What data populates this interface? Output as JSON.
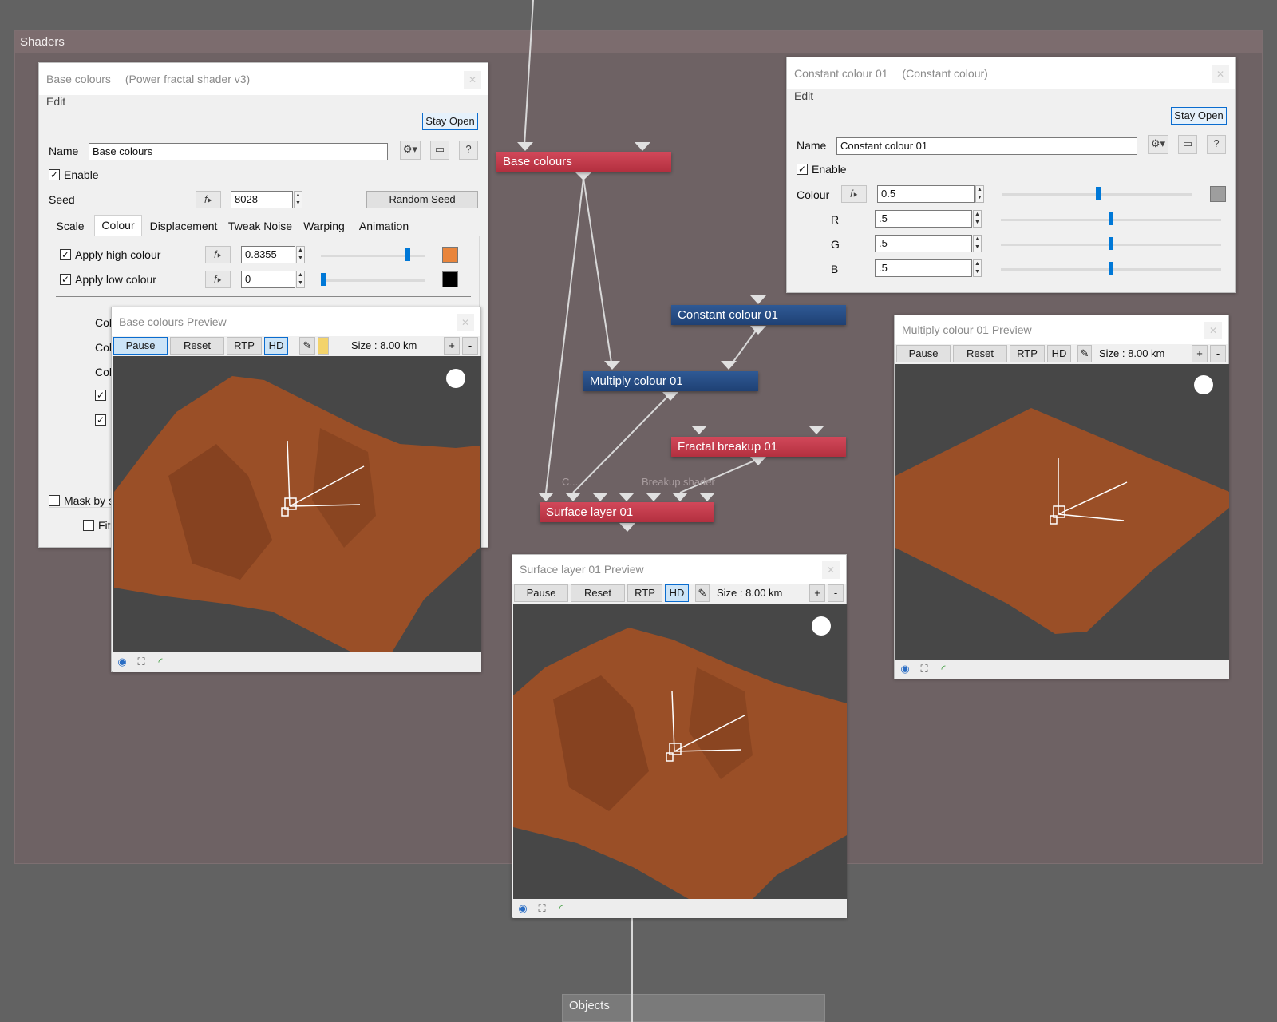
{
  "groups": {
    "shaders_title": "Shaders",
    "objects_title": "Objects"
  },
  "nodes": {
    "base_colours": "Base colours",
    "constant_colour": "Constant colour 01",
    "multiply_colour": "Multiply colour 01",
    "fractal_breakup": "Fractal breakup 01",
    "surface_layer": "Surface layer 01",
    "port_c": "C...",
    "port_breakup": "Breakup shader"
  },
  "base_window": {
    "title": "Base colours",
    "subtitle": "(Power fractal shader v3)",
    "menu_edit": "Edit",
    "stay_open": "Stay Open",
    "name_label": "Name",
    "name_value": "Base colours",
    "help": "?",
    "enable_label": "Enable",
    "seed_label": "Seed",
    "seed_value": "8028",
    "random_seed": "Random Seed",
    "tabs": [
      "Scale",
      "Colour",
      "Displacement",
      "Tweak Noise",
      "Warping",
      "Animation"
    ],
    "apply_high_label": "Apply high colour",
    "apply_high_value": "0.8355",
    "apply_high_level": 0.8355,
    "apply_low_label": "Apply low colour",
    "apply_low_value": "0",
    "apply_low_level": 0,
    "partial_rows": [
      "Col",
      "Col",
      "Col"
    ],
    "mask_label": "Mask by s",
    "fit_label": "Fit",
    "high_colour": "#e9853c",
    "low_colour": "#000000"
  },
  "constant_window": {
    "title": "Constant colour 01",
    "subtitle": "(Constant colour)",
    "menu_edit": "Edit",
    "stay_open": "Stay Open",
    "name_label": "Name",
    "name_value": "Constant colour 01",
    "help": "?",
    "enable_label": "Enable",
    "colour_label": "Colour",
    "colour_value": "0.5",
    "r_label": "R",
    "r_value": ".5",
    "g_label": "G",
    "g_value": ".5",
    "b_label": "B",
    "b_value": ".5",
    "swatch_color": "#9e9e9e"
  },
  "previews": {
    "base": {
      "title": "Base colours Preview",
      "pause": "Pause",
      "reset": "Reset",
      "rtp": "RTP",
      "hd": "HD",
      "size": "Size : 8.00 km",
      "plus": "+",
      "minus": "-"
    },
    "multiply": {
      "title": "Multiply colour 01 Preview",
      "pause": "Pause",
      "reset": "Reset",
      "rtp": "RTP",
      "hd": "HD",
      "size": "Size : 8.00 km",
      "plus": "+",
      "minus": "-"
    },
    "surface": {
      "title": "Surface layer 01 Preview",
      "pause": "Pause",
      "reset": "Reset",
      "rtp": "RTP",
      "hd": "HD",
      "size": "Size : 8.00 km",
      "plus": "+",
      "minus": "-"
    }
  },
  "colors": {
    "terrain": "#9a4f27",
    "terrain_dark": "#6e3418",
    "node_red": "#c23b4c",
    "node_blue": "#2a5089",
    "accent": "#0078d7"
  },
  "icons": [
    "gear-icon",
    "monitor-icon",
    "help-icon",
    "function-icon",
    "brush-icon",
    "sun-icon",
    "eye-icon",
    "fit-icon",
    "curve-icon",
    "spin-up-icon",
    "spin-down-icon",
    "close-icon"
  ]
}
